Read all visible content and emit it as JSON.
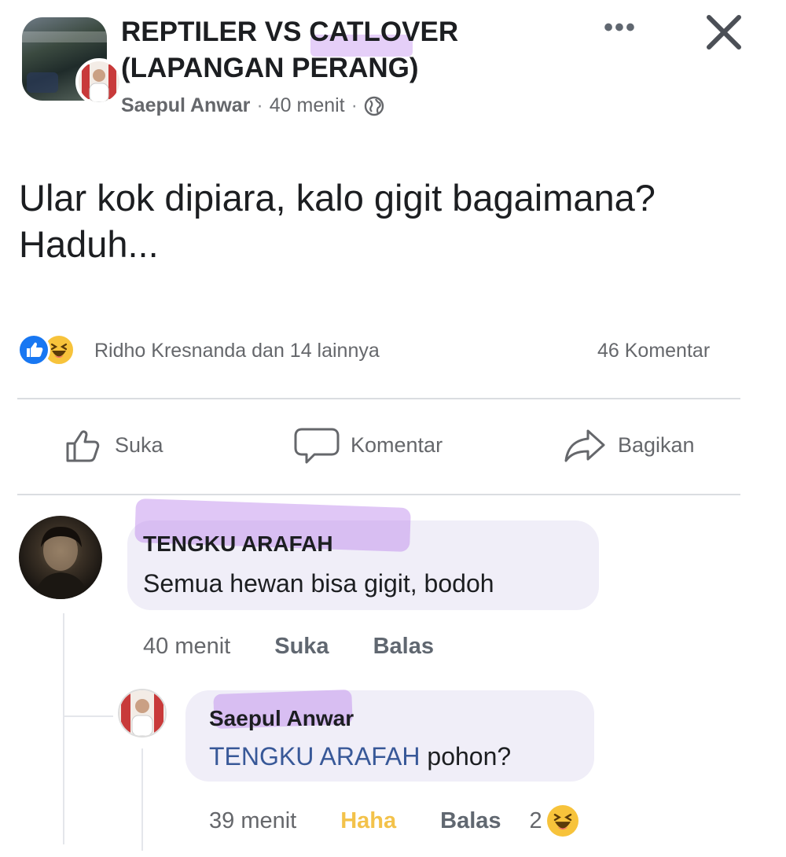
{
  "post": {
    "group_name": "REPTILER VS CATLOVER (LAPANGAN PERANG)",
    "author": "Saepul Anwar",
    "separator": "·",
    "time": "40 menit",
    "privacy_icon": "globe-icon",
    "text": "Ular kok dipiara, kalo gigit bagaimana? Haduh...",
    "more_label": "•••",
    "close_icon": "close-icon"
  },
  "engagement": {
    "reactions": [
      "like-reaction-icon",
      "haha-reaction-icon"
    ],
    "reactors_text": "Ridho Kresnanda dan 14 lainnya",
    "comment_count": "46 Komentar"
  },
  "actions": {
    "like": "Suka",
    "comment": "Komentar",
    "share": "Bagikan"
  },
  "comments": [
    {
      "author": "TENGKU ARAFAH",
      "text": "Semua hewan bisa gigit, bodoh",
      "time": "40 menit",
      "like": "Suka",
      "reply": "Balas",
      "replies": [
        {
          "author": "Saepul Anwar",
          "mention": "TENGKU ARAFAH",
          "text": " pohon?",
          "time": "39 menit",
          "reaction_label": "Haha",
          "reply": "Balas",
          "reaction_count": "2"
        }
      ]
    }
  ],
  "colors": {
    "accent_blue": "#1877f2",
    "mention_blue": "#385898",
    "haha_yellow": "#f7c33b",
    "highlight_purple": "#ba82ec",
    "bubble_bg": "#f0eef8",
    "meta_gray": "#65676b"
  }
}
